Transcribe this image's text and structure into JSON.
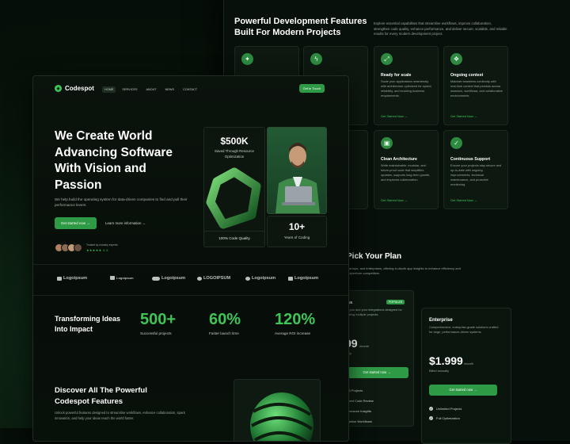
{
  "features": {
    "title": "Powerful Development Features Built For Modern Projects",
    "description": "Explore essential capabilities that streamline workflows, improve collaboration, strengthen code quality, enhance performance, and deliver secure, scalable, and reliable results for every modern development project.",
    "cards": [
      {
        "icon": "sparkle-icon",
        "title": "",
        "desc": "",
        "link": ""
      },
      {
        "icon": "bolt-icon",
        "title": "",
        "desc": "",
        "link": ""
      },
      {
        "icon": "scale-icon",
        "title": "Ready for scale",
        "desc": "Scale your applications seamlessly with architecture optimized for speed, reliability, and evolving business requirements.",
        "link": "Get Started Now"
      },
      {
        "icon": "context-icon",
        "title": "Ongoing context",
        "desc": "Maintain seamless continuity with real-time context that persists across sessions, workflows, and collaborative environments.",
        "link": "Get Started Now"
      },
      {
        "icon": "layers-icon",
        "title": "",
        "desc": "",
        "link": ""
      },
      {
        "icon": "code-icon",
        "title": "",
        "desc": "",
        "link": ""
      },
      {
        "icon": "architecture-icon",
        "title": "Clean Architecture",
        "desc": "Write maintainable, modular, and future-proof code that simplifies updates, supports long-term growth, and improves collaboration.",
        "link": "Get Started Now"
      },
      {
        "icon": "shield-icon",
        "title": "Continuous Support",
        "desc": "Ensure your projects stay secure and up-to-date with ongoing improvements, technical maintenance, and proactive monitoring.",
        "link": "Get Started Now"
      }
    ]
  },
  "plans": {
    "title": "Pick Your Plan",
    "subtitle": "startups, and enterprises, offering in-depth app insights to enhance efficiency and outperform competition.",
    "pro": {
      "name": "ess",
      "badge": "POPULAR",
      "desc": "for you and your integrations designed for scaling multiple projects.",
      "price": "99",
      "period": "/month",
      "billing": "ually",
      "cta": "Get started now",
      "features": [
        "to 5 Projects",
        "anced Code Review",
        "rformance Insights",
        "omation Workflows"
      ]
    },
    "enterprise": {
      "name": "Enterprise",
      "desc": "Comprehensive, enterprise-grade solutions crafted for large, performance-driven systems.",
      "price": "$1.999",
      "period": "/month",
      "billing": "Billed annually",
      "cta": "Get started now",
      "features": [
        "Unlimited Projects",
        "Full Optimization"
      ]
    }
  },
  "nav": {
    "brand": "Codespot",
    "items": [
      "HOME",
      "SERVICES",
      "ABOUT",
      "NEWS",
      "CONTACT"
    ],
    "cta": "Get in Touch"
  },
  "hero": {
    "title": "We Create World Advancing Software With Vision and Passion",
    "description": "We help build the operating system for data-driven companies to find and pull their performance levers.",
    "cta": "Get started now",
    "link": "Learn more information",
    "trusted": "Trusted by industry experts",
    "rating": "★★★★★ 4.9",
    "stat_main": {
      "value": "$500K",
      "label": "Saved Through Resource Optimization"
    },
    "stat_years": {
      "value": "10+",
      "label": "Years of Coding"
    },
    "stat_quality": "100%  Code Quality"
  },
  "logos": [
    "Logoipsum",
    "Logoipsum",
    "Logoipsum",
    "LOGOIPSUM",
    "Logoipsum",
    "Logoipsum"
  ],
  "impact": {
    "title": "Transforming Ideas Into Impact",
    "stats": [
      {
        "value": "500+",
        "label": "Successful projects"
      },
      {
        "value": "60%",
        "label": "Faster launch time"
      },
      {
        "value": "120%",
        "label": "Average ROI increase"
      }
    ]
  },
  "discover": {
    "title": "Discover All The Powerful Codespot Features",
    "description": "Unlock powerful features designed to streamline workflows, enhance collaboration, spark innovation, and help your ideas reach the world faster."
  },
  "colors": {
    "accent": "#3fc456",
    "button": "#2f9a45",
    "background": "#07100a"
  }
}
